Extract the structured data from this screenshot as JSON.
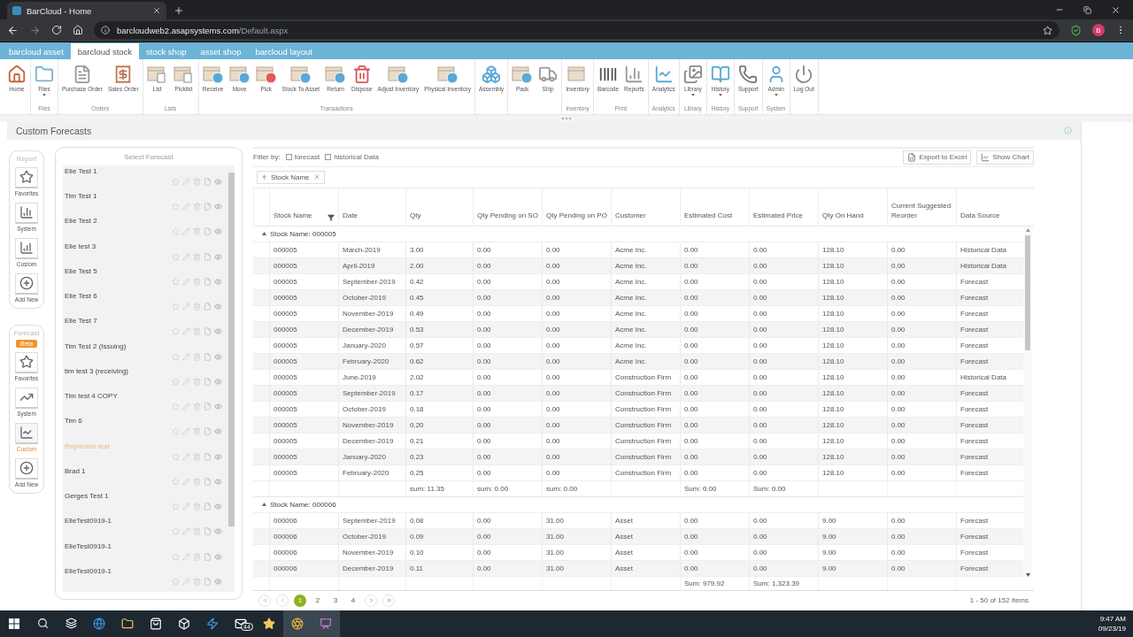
{
  "browser": {
    "tab_title": "BarCloud - Home",
    "url_host": "barcloudweb2.asapsystems.com",
    "url_path": "/Default.aspx",
    "avatar": "B"
  },
  "app_tabs": [
    {
      "label": "barcloud asset",
      "selected": false
    },
    {
      "label": "barcloud stock",
      "selected": true
    },
    {
      "label": "stock shop",
      "selected": false
    },
    {
      "label": "asset shop",
      "selected": false
    },
    {
      "label": "barcloud layout",
      "selected": false
    }
  ],
  "ribbon": [
    {
      "items": [
        {
          "label": "Home",
          "kind": "home",
          "dropdown": false
        }
      ]
    },
    {
      "label": "Files",
      "items": [
        {
          "label": "Files",
          "kind": "folder",
          "dropdown": true
        }
      ]
    },
    {
      "label": "Orders",
      "items": [
        {
          "label": "Purchase Order",
          "kind": "document",
          "dropdown": false
        },
        {
          "label": "Sales Order",
          "kind": "invoice",
          "dropdown": false
        }
      ]
    },
    {
      "label": "Lists",
      "items": [
        {
          "label": "List",
          "kind": "box-doc",
          "dropdown": false
        },
        {
          "label": "Picklist",
          "kind": "box-doc",
          "dropdown": false
        }
      ]
    },
    {
      "label": "Transactions",
      "items": [
        {
          "label": "Receive",
          "kind": "box-blue",
          "dropdown": false
        },
        {
          "label": "Move",
          "kind": "box-blue",
          "dropdown": false
        },
        {
          "label": "Pick",
          "kind": "box-red",
          "dropdown": false
        },
        {
          "label": "Stock To Asset",
          "kind": "box-blue",
          "dropdown": false
        },
        {
          "label": "Return",
          "kind": "box-blue",
          "dropdown": false
        },
        {
          "label": "Dispose",
          "kind": "trash-red",
          "dropdown": false
        },
        {
          "label": "Adjust Inventory",
          "kind": "box-blue",
          "dropdown": false
        },
        {
          "label": "Physical Inventory",
          "kind": "box-blue",
          "dropdown": false
        }
      ]
    },
    {
      "items": [
        {
          "label": "Assembly",
          "kind": "assembly",
          "dropdown": false
        }
      ]
    },
    {
      "items": [
        {
          "label": "Pack",
          "kind": "box-blue",
          "dropdown": false
        },
        {
          "label": "Ship",
          "kind": "truck",
          "dropdown": false
        }
      ]
    },
    {
      "label": "Inventory",
      "items": [
        {
          "label": "Inventory",
          "kind": "box",
          "dropdown": false
        }
      ]
    },
    {
      "label": "Print",
      "items": [
        {
          "label": "Barcode",
          "kind": "barcode",
          "dropdown": false
        },
        {
          "label": "Reports",
          "kind": "report",
          "dropdown": false
        }
      ]
    },
    {
      "label": "Analytics",
      "items": [
        {
          "label": "Analytics",
          "kind": "analytics",
          "dropdown": false
        }
      ]
    },
    {
      "label": "Library",
      "items": [
        {
          "label": "Library",
          "kind": "library",
          "dropdown": true
        }
      ]
    },
    {
      "label": "History",
      "items": [
        {
          "label": "History",
          "kind": "book",
          "dropdown": true
        }
      ]
    },
    {
      "label": "Support",
      "items": [
        {
          "label": "Support",
          "kind": "phone",
          "dropdown": false
        }
      ]
    },
    {
      "label": "System",
      "items": [
        {
          "label": "Admin",
          "kind": "person",
          "dropdown": true
        }
      ]
    },
    {
      "items": [
        {
          "label": "Log Out",
          "kind": "power",
          "dropdown": false
        }
      ]
    }
  ],
  "page_title": "Custom Forecasts",
  "sidebar": [
    {
      "heading": "Report",
      "items": [
        {
          "label": "Favorites",
          "kind": "star",
          "selected": false
        },
        {
          "label": "System",
          "kind": "bars",
          "selected": false
        },
        {
          "label": "Custom",
          "kind": "bars-rising",
          "selected": false
        },
        {
          "label": "Add New",
          "kind": "add",
          "selected": false
        }
      ]
    },
    {
      "heading": "Forecast",
      "badge": "Beta",
      "items": [
        {
          "label": "Favorites",
          "kind": "star",
          "selected": false
        },
        {
          "label": "System",
          "kind": "trend",
          "selected": false
        },
        {
          "label": "Custom",
          "kind": "line",
          "selected": true
        },
        {
          "label": "Add New",
          "kind": "add",
          "selected": false
        }
      ]
    }
  ],
  "forecast_list": {
    "heading": "Select Forecast",
    "items": [
      {
        "name": "Elie Test 1",
        "hovered": false
      },
      {
        "name": "Tim Test 1",
        "hovered": false
      },
      {
        "name": "Elie Test 2",
        "hovered": false
      },
      {
        "name": "Elie test 3",
        "hovered": false
      },
      {
        "name": "Elie Test 5",
        "hovered": false
      },
      {
        "name": "Elie Test 6",
        "hovered": false
      },
      {
        "name": "Elie Test 7",
        "hovered": false
      },
      {
        "name": "Tim Test 2 (Issuing)",
        "hovered": false
      },
      {
        "name": "tim test 3 (receiving)",
        "hovered": false
      },
      {
        "name": "Tim test 4 COPY",
        "hovered": false
      },
      {
        "name": "Tim 6",
        "hovered": false
      },
      {
        "name": "Replenish test",
        "hovered": true
      },
      {
        "name": "Brad 1",
        "hovered": false
      },
      {
        "name": "Gerges Test 1",
        "hovered": false
      },
      {
        "name": "ElieTest0919-1",
        "hovered": false
      },
      {
        "name": "ElieTest0919-1",
        "hovered": false
      },
      {
        "name": "ElieTest0919-1",
        "hovered": false
      }
    ]
  },
  "filter": {
    "label": "Filter by:",
    "options": [
      {
        "label": "forecast",
        "checked": false
      },
      {
        "label": "historical Data",
        "checked": false
      }
    ]
  },
  "actions": [
    {
      "label": "Export to Excel",
      "kind": "excel"
    },
    {
      "label": "Show Chart",
      "kind": "chart"
    }
  ],
  "group_chip": "Stock Name",
  "table": {
    "columns": [
      "Stock Name",
      "Date",
      "Qty",
      "Qty Pending on SO",
      "Qty Pending on PO",
      "Customer",
      "Estimated Cost",
      "Estimated Price",
      "Qty On Hand",
      "Current Suggested Reorder",
      "Data Source"
    ],
    "groups": [
      {
        "title": "Stock Name: 000005",
        "rows": [
          [
            "000005",
            "March-2019",
            "3.00",
            "0.00",
            "0.00",
            "Acme Inc.",
            "0.00",
            "0.00",
            "128.10",
            "0.00",
            "Historical Data"
          ],
          [
            "000005",
            "April-2019",
            "2.00",
            "0.00",
            "0.00",
            "Acme Inc.",
            "0.00",
            "0.00",
            "128.10",
            "0.00",
            "Historical Data"
          ],
          [
            "000005",
            "September-2019",
            "0.42",
            "0.00",
            "0.00",
            "Acme Inc.",
            "0.00",
            "0.00",
            "128.10",
            "0.00",
            "Forecast"
          ],
          [
            "000005",
            "October-2019",
            "0.45",
            "0.00",
            "0.00",
            "Acme Inc.",
            "0.00",
            "0.00",
            "128.10",
            "0.00",
            "Forecast"
          ],
          [
            "000005",
            "November-2019",
            "0.49",
            "0.00",
            "0.00",
            "Acme Inc.",
            "0.00",
            "0.00",
            "128.10",
            "0.00",
            "Forecast"
          ],
          [
            "000005",
            "December-2019",
            "0.53",
            "0.00",
            "0.00",
            "Acme Inc.",
            "0.00",
            "0.00",
            "128.10",
            "0.00",
            "Forecast"
          ],
          [
            "000005",
            "January-2020",
            "0.57",
            "0.00",
            "0.00",
            "Acme Inc.",
            "0.00",
            "0.00",
            "128.10",
            "0.00",
            "Forecast"
          ],
          [
            "000005",
            "February-2020",
            "0.62",
            "0.00",
            "0.00",
            "Acme Inc.",
            "0.00",
            "0.00",
            "128.10",
            "0.00",
            "Forecast"
          ],
          [
            "000005",
            "June-2019",
            "2.02",
            "0.00",
            "0.00",
            "Construction Firm",
            "0.00",
            "0.00",
            "128.10",
            "0.00",
            "Historical Data"
          ],
          [
            "000005",
            "September-2019",
            "0.17",
            "0.00",
            "0.00",
            "Construction Firm",
            "0.00",
            "0.00",
            "128.10",
            "0.00",
            "Forecast"
          ],
          [
            "000005",
            "October-2019",
            "0.18",
            "0.00",
            "0.00",
            "Construction Firm",
            "0.00",
            "0.00",
            "128.10",
            "0.00",
            "Forecast"
          ],
          [
            "000005",
            "November-2019",
            "0.20",
            "0.00",
            "0.00",
            "Construction Firm",
            "0.00",
            "0.00",
            "128.10",
            "0.00",
            "Forecast"
          ],
          [
            "000005",
            "December-2019",
            "0.21",
            "0.00",
            "0.00",
            "Construction Firm",
            "0.00",
            "0.00",
            "128.10",
            "0.00",
            "Forecast"
          ],
          [
            "000005",
            "January-2020",
            "0.23",
            "0.00",
            "0.00",
            "Construction Firm",
            "0.00",
            "0.00",
            "128.10",
            "0.00",
            "Forecast"
          ],
          [
            "000005",
            "February-2020",
            "0.25",
            "0.00",
            "0.00",
            "Construction Firm",
            "0.00",
            "0.00",
            "128.10",
            "0.00",
            "Forecast"
          ]
        ],
        "sums": {
          "qty": "sum: 11.35",
          "qty_pending_on_so": "sum: 0.00",
          "qty_pending_on_po": "sum: 0.00",
          "estimated_cost": "Sum: 0.00",
          "estimated_price": "Sum: 0.00"
        }
      },
      {
        "title": "Stock Name: 000006",
        "rows": [
          [
            "000006",
            "September-2019",
            "0.08",
            "0.00",
            "31.00",
            "Asset",
            "0.00",
            "0.00",
            "9.00",
            "0.00",
            "Forecast"
          ],
          [
            "000006",
            "October-2019",
            "0.09",
            "0.00",
            "31.00",
            "Asset",
            "0.00",
            "0.00",
            "9.00",
            "0.00",
            "Forecast"
          ],
          [
            "000006",
            "November-2019",
            "0.10",
            "0.00",
            "31.00",
            "Asset",
            "0.00",
            "0.00",
            "9.00",
            "0.00",
            "Forecast"
          ],
          [
            "000006",
            "December-2019",
            "0.11",
            "0.00",
            "31.00",
            "Asset",
            "0.00",
            "0.00",
            "9.00",
            "0.00",
            "Forecast"
          ]
        ]
      }
    ],
    "footer": {
      "estimated_cost": "Sum: 979.92",
      "estimated_price": "Sum: 1,323.39"
    }
  },
  "pager": {
    "pages": [
      {
        "label": "1",
        "selected": true
      },
      {
        "label": "2",
        "selected": false
      },
      {
        "label": "3",
        "selected": false
      },
      {
        "label": "4",
        "selected": false
      }
    ],
    "info": "1 - 50 of 152 items"
  },
  "taskbar": {
    "mail_badge": "44",
    "time": "9:47 AM",
    "date": "09/23/19"
  }
}
